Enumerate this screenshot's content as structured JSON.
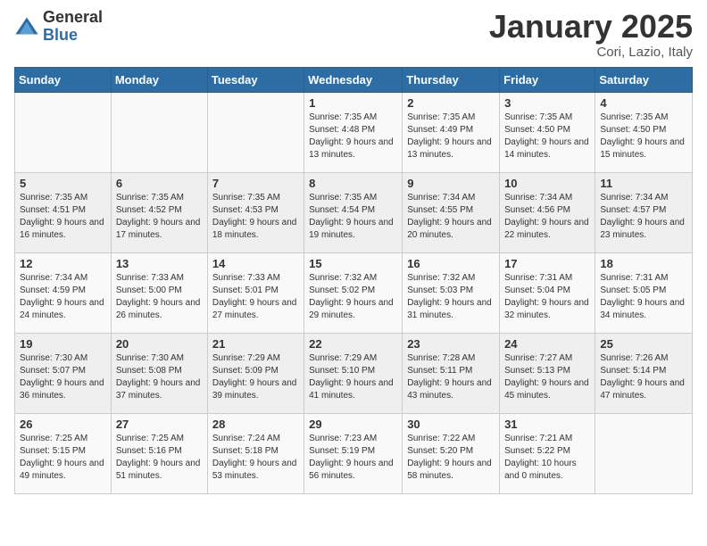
{
  "logo": {
    "general": "General",
    "blue": "Blue"
  },
  "title": "January 2025",
  "location": "Cori, Lazio, Italy",
  "days_of_week": [
    "Sunday",
    "Monday",
    "Tuesday",
    "Wednesday",
    "Thursday",
    "Friday",
    "Saturday"
  ],
  "weeks": [
    [
      {
        "day": "",
        "info": ""
      },
      {
        "day": "",
        "info": ""
      },
      {
        "day": "",
        "info": ""
      },
      {
        "day": "1",
        "info": "Sunrise: 7:35 AM\nSunset: 4:48 PM\nDaylight: 9 hours and 13 minutes."
      },
      {
        "day": "2",
        "info": "Sunrise: 7:35 AM\nSunset: 4:49 PM\nDaylight: 9 hours and 13 minutes."
      },
      {
        "day": "3",
        "info": "Sunrise: 7:35 AM\nSunset: 4:50 PM\nDaylight: 9 hours and 14 minutes."
      },
      {
        "day": "4",
        "info": "Sunrise: 7:35 AM\nSunset: 4:50 PM\nDaylight: 9 hours and 15 minutes."
      }
    ],
    [
      {
        "day": "5",
        "info": "Sunrise: 7:35 AM\nSunset: 4:51 PM\nDaylight: 9 hours and 16 minutes."
      },
      {
        "day": "6",
        "info": "Sunrise: 7:35 AM\nSunset: 4:52 PM\nDaylight: 9 hours and 17 minutes."
      },
      {
        "day": "7",
        "info": "Sunrise: 7:35 AM\nSunset: 4:53 PM\nDaylight: 9 hours and 18 minutes."
      },
      {
        "day": "8",
        "info": "Sunrise: 7:35 AM\nSunset: 4:54 PM\nDaylight: 9 hours and 19 minutes."
      },
      {
        "day": "9",
        "info": "Sunrise: 7:34 AM\nSunset: 4:55 PM\nDaylight: 9 hours and 20 minutes."
      },
      {
        "day": "10",
        "info": "Sunrise: 7:34 AM\nSunset: 4:56 PM\nDaylight: 9 hours and 22 minutes."
      },
      {
        "day": "11",
        "info": "Sunrise: 7:34 AM\nSunset: 4:57 PM\nDaylight: 9 hours and 23 minutes."
      }
    ],
    [
      {
        "day": "12",
        "info": "Sunrise: 7:34 AM\nSunset: 4:59 PM\nDaylight: 9 hours and 24 minutes."
      },
      {
        "day": "13",
        "info": "Sunrise: 7:33 AM\nSunset: 5:00 PM\nDaylight: 9 hours and 26 minutes."
      },
      {
        "day": "14",
        "info": "Sunrise: 7:33 AM\nSunset: 5:01 PM\nDaylight: 9 hours and 27 minutes."
      },
      {
        "day": "15",
        "info": "Sunrise: 7:32 AM\nSunset: 5:02 PM\nDaylight: 9 hours and 29 minutes."
      },
      {
        "day": "16",
        "info": "Sunrise: 7:32 AM\nSunset: 5:03 PM\nDaylight: 9 hours and 31 minutes."
      },
      {
        "day": "17",
        "info": "Sunrise: 7:31 AM\nSunset: 5:04 PM\nDaylight: 9 hours and 32 minutes."
      },
      {
        "day": "18",
        "info": "Sunrise: 7:31 AM\nSunset: 5:05 PM\nDaylight: 9 hours and 34 minutes."
      }
    ],
    [
      {
        "day": "19",
        "info": "Sunrise: 7:30 AM\nSunset: 5:07 PM\nDaylight: 9 hours and 36 minutes."
      },
      {
        "day": "20",
        "info": "Sunrise: 7:30 AM\nSunset: 5:08 PM\nDaylight: 9 hours and 37 minutes."
      },
      {
        "day": "21",
        "info": "Sunrise: 7:29 AM\nSunset: 5:09 PM\nDaylight: 9 hours and 39 minutes."
      },
      {
        "day": "22",
        "info": "Sunrise: 7:29 AM\nSunset: 5:10 PM\nDaylight: 9 hours and 41 minutes."
      },
      {
        "day": "23",
        "info": "Sunrise: 7:28 AM\nSunset: 5:11 PM\nDaylight: 9 hours and 43 minutes."
      },
      {
        "day": "24",
        "info": "Sunrise: 7:27 AM\nSunset: 5:13 PM\nDaylight: 9 hours and 45 minutes."
      },
      {
        "day": "25",
        "info": "Sunrise: 7:26 AM\nSunset: 5:14 PM\nDaylight: 9 hours and 47 minutes."
      }
    ],
    [
      {
        "day": "26",
        "info": "Sunrise: 7:25 AM\nSunset: 5:15 PM\nDaylight: 9 hours and 49 minutes."
      },
      {
        "day": "27",
        "info": "Sunrise: 7:25 AM\nSunset: 5:16 PM\nDaylight: 9 hours and 51 minutes."
      },
      {
        "day": "28",
        "info": "Sunrise: 7:24 AM\nSunset: 5:18 PM\nDaylight: 9 hours and 53 minutes."
      },
      {
        "day": "29",
        "info": "Sunrise: 7:23 AM\nSunset: 5:19 PM\nDaylight: 9 hours and 56 minutes."
      },
      {
        "day": "30",
        "info": "Sunrise: 7:22 AM\nSunset: 5:20 PM\nDaylight: 9 hours and 58 minutes."
      },
      {
        "day": "31",
        "info": "Sunrise: 7:21 AM\nSunset: 5:22 PM\nDaylight: 10 hours and 0 minutes."
      },
      {
        "day": "",
        "info": ""
      }
    ]
  ]
}
